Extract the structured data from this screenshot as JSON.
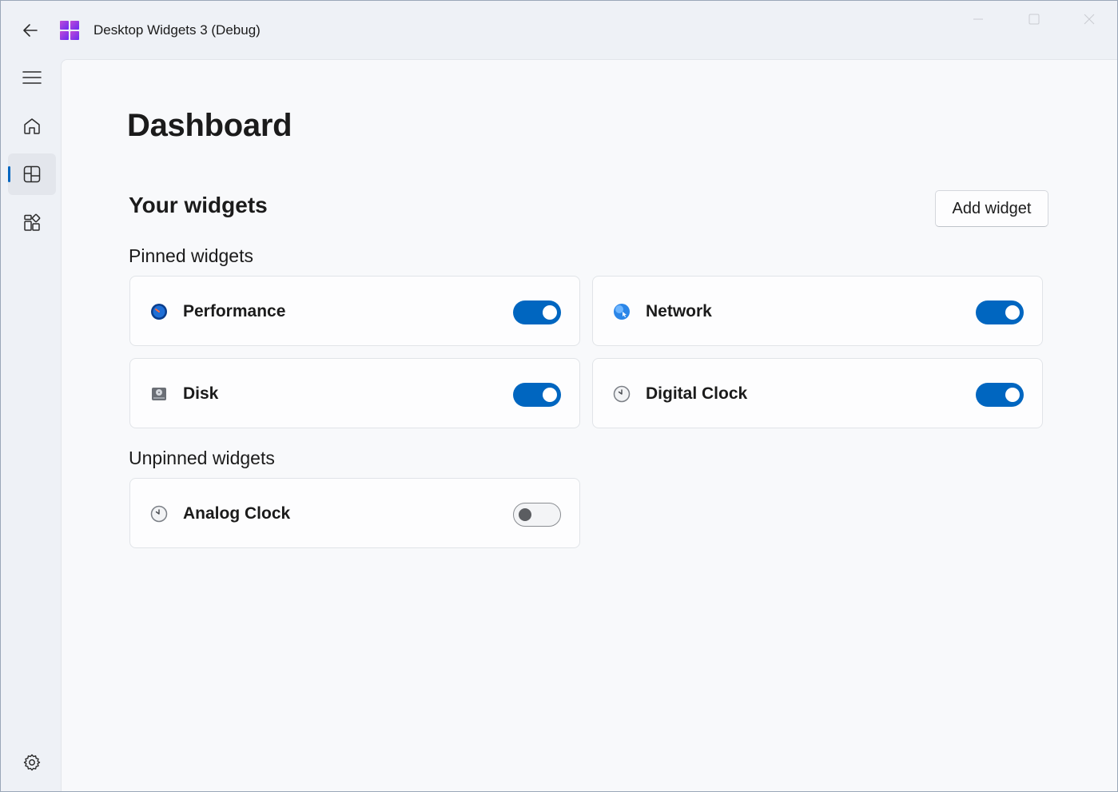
{
  "titlebar": {
    "app_title": "Desktop Widgets 3 (Debug)"
  },
  "nav": {
    "items": [
      {
        "name": "menu",
        "icon": "hamburger-icon",
        "selected": false
      },
      {
        "name": "home",
        "icon": "home-icon",
        "selected": false
      },
      {
        "name": "dashboard",
        "icon": "dashboard-icon",
        "selected": true
      },
      {
        "name": "widget-store",
        "icon": "widgets-icon",
        "selected": false
      },
      {
        "name": "settings",
        "icon": "gear-icon",
        "selected": false
      }
    ]
  },
  "page": {
    "title": "Dashboard",
    "section_title": "Your widgets",
    "add_widget_label": "Add widget",
    "pinned_label": "Pinned widgets",
    "unpinned_label": "Unpinned widgets"
  },
  "pinned": [
    {
      "label": "Performance",
      "icon": "performance-icon",
      "enabled": true
    },
    {
      "label": "Network",
      "icon": "network-icon",
      "enabled": true
    },
    {
      "label": "Disk",
      "icon": "disk-icon",
      "enabled": true
    },
    {
      "label": "Digital Clock",
      "icon": "clock-icon",
      "enabled": true
    }
  ],
  "unpinned": [
    {
      "label": "Analog Clock",
      "icon": "clock-icon",
      "enabled": false
    }
  ],
  "colors": {
    "accent": "#0066c0",
    "background": "#f8f9fb",
    "logo": "#9b3fe0"
  }
}
